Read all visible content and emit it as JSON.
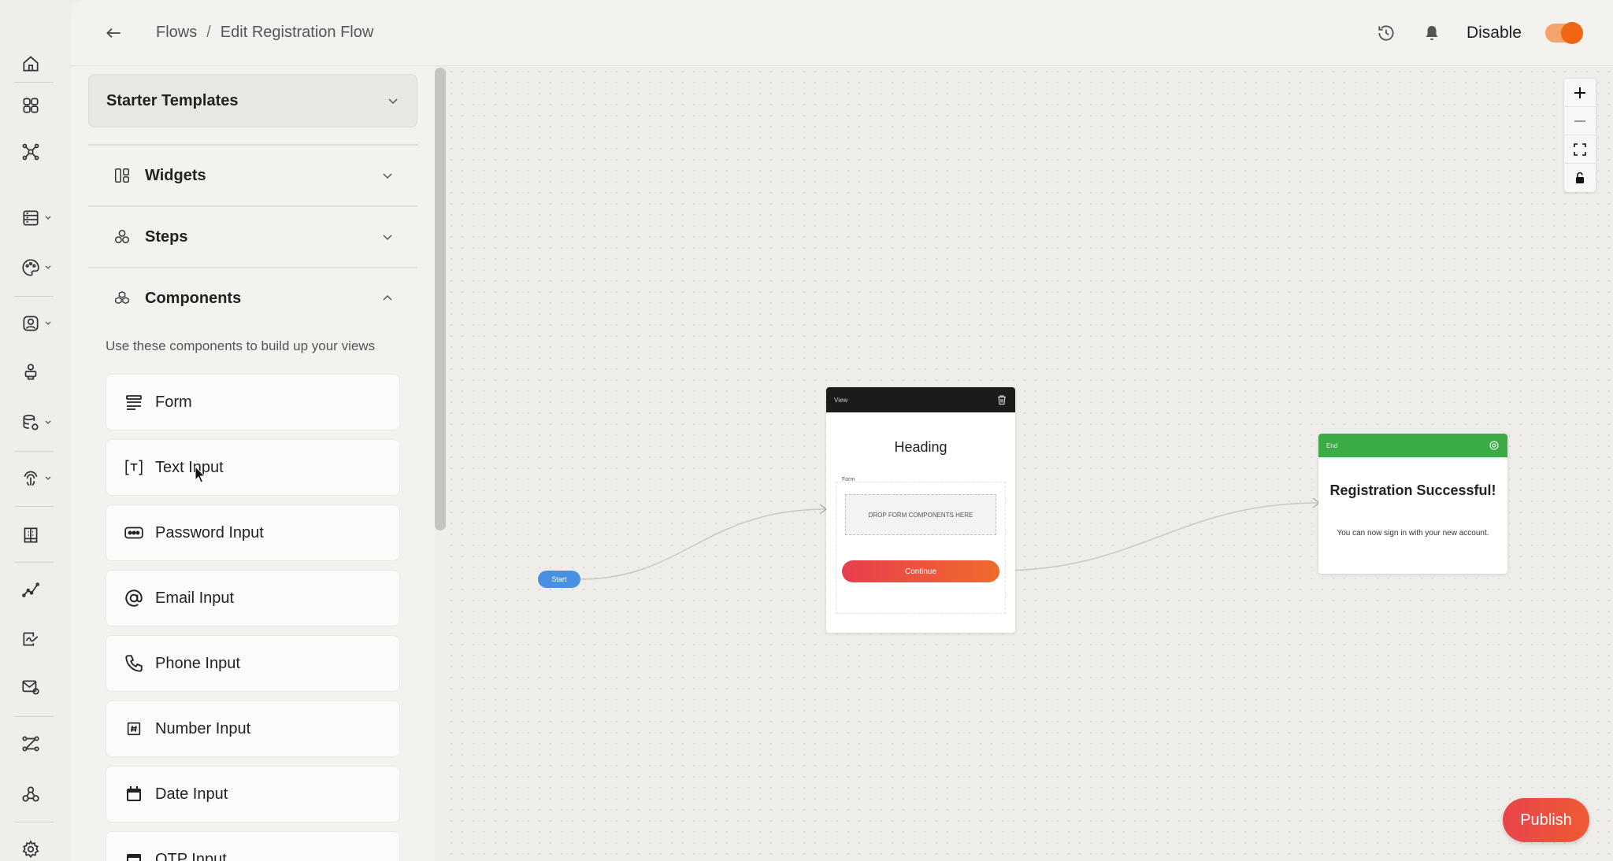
{
  "breadcrumb": {
    "root": "Flows",
    "separator": "/",
    "current": "Edit Registration Flow"
  },
  "header": {
    "disable_label": "Disable"
  },
  "rail": {
    "items": [
      {
        "icon": "home-icon"
      },
      {
        "icon": "apps-grid-icon"
      },
      {
        "icon": "network-icon"
      },
      {
        "icon": "database-list-icon"
      },
      {
        "icon": "palette-icon"
      },
      {
        "icon": "user-badge-icon"
      },
      {
        "icon": "user-stand-icon"
      },
      {
        "icon": "data-settings-icon"
      },
      {
        "icon": "fingerprint-icon"
      },
      {
        "icon": "building-icon"
      },
      {
        "icon": "analytics-line-icon"
      },
      {
        "icon": "signature-icon"
      },
      {
        "icon": "mail-settings-icon"
      },
      {
        "icon": "flows-icon"
      },
      {
        "icon": "webhook-icon"
      },
      {
        "icon": "settings-gear-icon"
      }
    ]
  },
  "panel": {
    "starter_templates": "Starter Templates",
    "sections": {
      "widgets": "Widgets",
      "steps": "Steps",
      "components": "Components"
    },
    "components_description": "Use these components to build up your views",
    "components": [
      {
        "label": "Form",
        "icon": "form-icon"
      },
      {
        "label": "Text Input",
        "icon": "text-input-icon"
      },
      {
        "label": "Password Input",
        "icon": "password-icon"
      },
      {
        "label": "Email Input",
        "icon": "at-icon"
      },
      {
        "label": "Phone Input",
        "icon": "phone-icon"
      },
      {
        "label": "Number Input",
        "icon": "hash-icon"
      },
      {
        "label": "Date Input",
        "icon": "calendar-icon"
      },
      {
        "label": "OTP Input",
        "icon": "otp-icon"
      }
    ]
  },
  "canvas": {
    "start_label": "Start",
    "view_node": {
      "header": "View",
      "heading": "Heading",
      "form_label": "Form",
      "drop_text": "DROP FORM COMPONENTS HERE",
      "button": "Continue"
    },
    "end_node": {
      "header": "End",
      "title": "Registration Successful!",
      "message": "You can now sign in with your new account."
    }
  },
  "actions": {
    "publish": "Publish"
  },
  "colors": {
    "accent_orange": "#f06414",
    "start_blue": "#4a90e2",
    "end_green": "#3bab45",
    "publish_red": "#e8444c"
  }
}
